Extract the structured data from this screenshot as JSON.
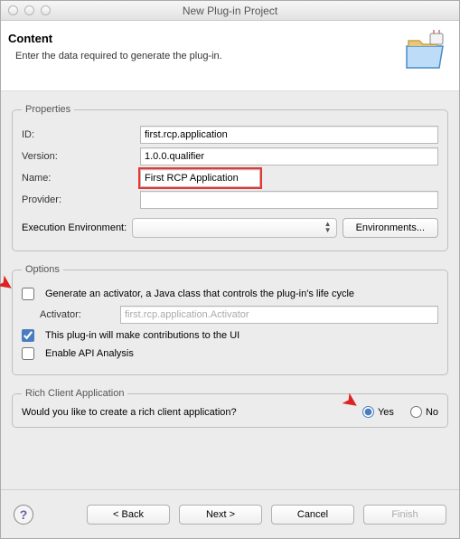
{
  "window": {
    "title": "New Plug-in Project"
  },
  "header": {
    "title": "Content",
    "subtitle": "Enter the data required to generate the plug-in."
  },
  "properties": {
    "legend": "Properties",
    "id_label": "ID:",
    "id_value": "first.rcp.application",
    "version_label": "Version:",
    "version_value": "1.0.0.qualifier",
    "name_label": "Name:",
    "name_value": "First RCP Application",
    "provider_label": "Provider:",
    "provider_value": "",
    "exec_env_label": "Execution Environment:",
    "exec_env_value": "",
    "env_button": "Environments..."
  },
  "options": {
    "legend": "Options",
    "generate_activator": "Generate an activator, a Java class that controls the plug-in's life cycle",
    "activator_label": "Activator:",
    "activator_value": "first.rcp.application.Activator",
    "ui_contrib": "This plug-in will make contributions to the UI",
    "api_analysis": "Enable API Analysis"
  },
  "rca": {
    "legend": "Rich Client Application",
    "question": "Would you like to create a rich client application?",
    "yes": "Yes",
    "no": "No"
  },
  "footer": {
    "back": "< Back",
    "next": "Next >",
    "cancel": "Cancel",
    "finish": "Finish"
  }
}
